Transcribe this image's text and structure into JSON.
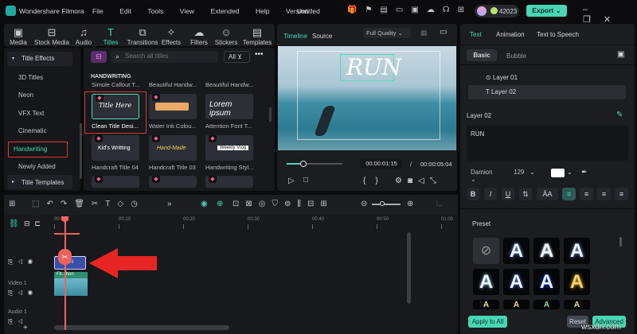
{
  "app": {
    "name": "Wondershare Filmora",
    "project": "Untitled",
    "credits": "42023",
    "export": "Export",
    "menu": [
      "File",
      "Edit",
      "Tools",
      "View",
      "Extended",
      "Help",
      "Version"
    ]
  },
  "toolbar": [
    {
      "label": "Media",
      "icon": "media-icon"
    },
    {
      "label": "Stock Media",
      "icon": "stock-media-icon"
    },
    {
      "label": "Audio",
      "icon": "audio-icon"
    },
    {
      "label": "Titles",
      "icon": "titles-icon",
      "active": true
    },
    {
      "label": "Transitions",
      "icon": "transitions-icon"
    },
    {
      "label": "Effects",
      "icon": "effects-icon"
    },
    {
      "label": "Filters",
      "icon": "filters-icon"
    },
    {
      "label": "Stickers",
      "icon": "stickers-icon"
    },
    {
      "label": "Templates",
      "icon": "templates-icon"
    }
  ],
  "sidebar": {
    "group": "Title Effects",
    "items": [
      "3D Titles",
      "Neon",
      "VFX Text",
      "Cinematic",
      "Handwriting",
      "Newly Added"
    ],
    "selected": "Handwriting",
    "group2": "Title Templates"
  },
  "library": {
    "search_placeholder": "Search all titles",
    "filter": "All",
    "section": "HANDWRITING",
    "prev_row": [
      "Simple Callout T...",
      "Beautiful Handw...",
      "Beautiful Handw..."
    ],
    "items": [
      {
        "label": "Clean Title Desi...",
        "preview": "Title Here",
        "selected": true
      },
      {
        "label": "Water Ink Colou...",
        "preview": ""
      },
      {
        "label": "Attention Font T...",
        "preview": "Lorem ipsum"
      },
      {
        "label": "Handcraft Title 04",
        "preview": "Kid's Writting"
      },
      {
        "label": "Handcraft Title 03",
        "preview": "Hand-Made"
      },
      {
        "label": "Handwriting Styl...",
        "preview": "Weekly Vlog"
      }
    ]
  },
  "preview": {
    "tabs": [
      "Timeline",
      "Source"
    ],
    "active_tab": "Timeline",
    "quality": "Full Quality",
    "title_text": "RUN",
    "current_time": "00:00:01:15",
    "separator": "/",
    "total_time": "00:00:05:04",
    "progress": 0.3
  },
  "inspector": {
    "tabs": [
      "Text",
      "Animation",
      "Text to Speech"
    ],
    "active_tab": "Text",
    "subtabs": [
      "Basic",
      "Bubble"
    ],
    "active_subtab": "Basic",
    "layers": [
      "Layer 01",
      "Layer 02"
    ],
    "selected_layer": "Layer 02",
    "layer_title": "Layer 02",
    "text_value": "RUN",
    "font": "Damion",
    "size": "129",
    "color": "#ffffff",
    "format_buttons": [
      "B",
      "I",
      "U"
    ],
    "preset_label": "Preset",
    "apply_all": "Apply to All",
    "reset": "Reset",
    "advanced": "Advanced",
    "preset_colors": [
      "#6aa8ff",
      "#ffffff",
      "#9ab0ff",
      "#9fd0ff",
      "#e6f0ff",
      "#4f7dff",
      "#f4b63a"
    ]
  },
  "timeline": {
    "ruler": [
      "00:00",
      "00:10",
      "00:20",
      "00:30",
      "00:40",
      "00:50",
      "01:00"
    ],
    "title_clip": "RUN",
    "video_clip": "Fit...hon",
    "tracks": [
      "Video 1",
      "Audio 1"
    ]
  },
  "watermark": "wsxdn.com",
  "colors": {
    "accent": "#48d6b4",
    "highlight": "#e03a3a",
    "playhead": "#f0625f"
  }
}
